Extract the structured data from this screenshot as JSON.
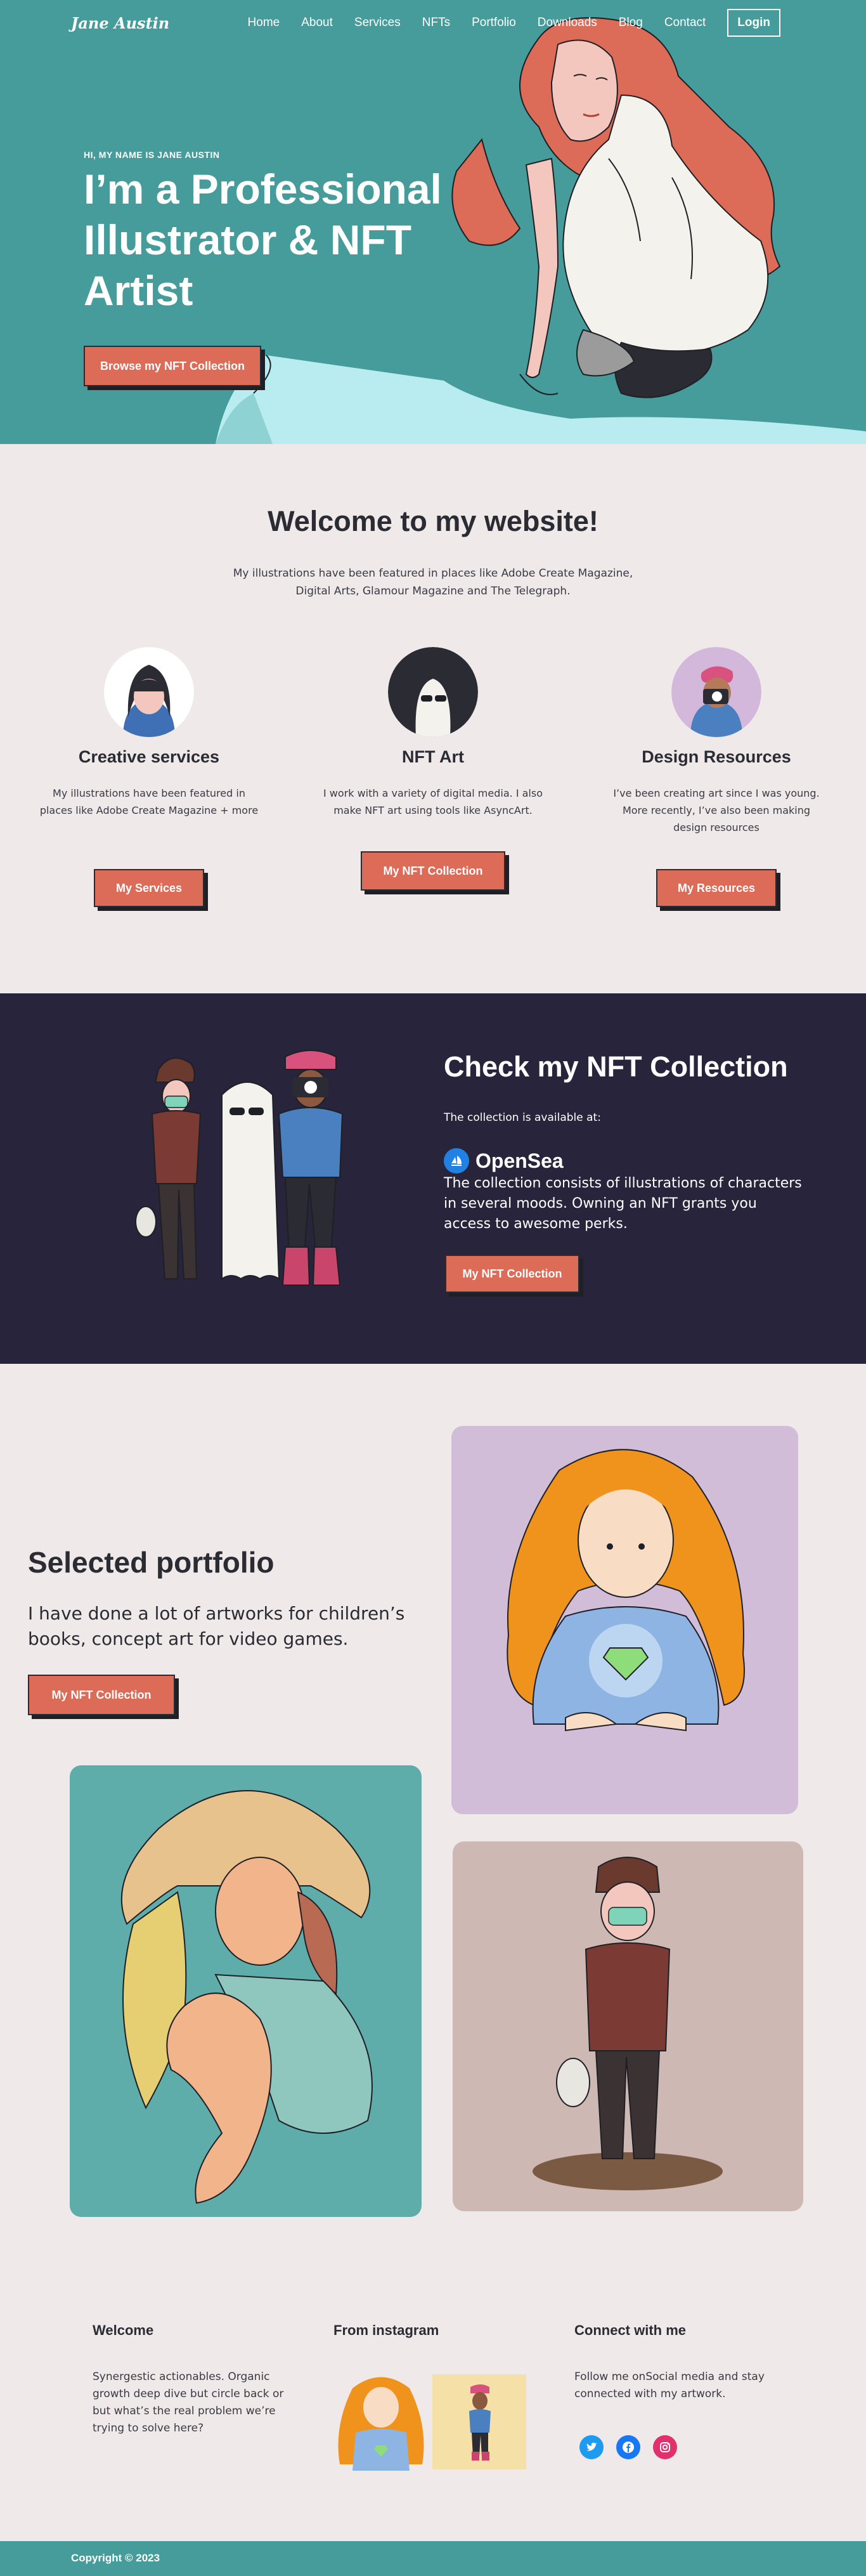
{
  "header": {
    "logo": "Jane Austin",
    "nav": [
      "Home",
      "About",
      "Services",
      "NFTs",
      "Portfolio",
      "Downloads",
      "Blog",
      "Contact"
    ],
    "login": "Login"
  },
  "hero": {
    "eyebrow": "HI, MY NAME IS JANE AUSTIN",
    "title": "I’m a Professional Illustrator & NFT Artist",
    "cta": "Browse my NFT Collection"
  },
  "welcome": {
    "title": "Welcome to my website!",
    "subtitle": "My illustrations have been featured in places like Adobe Create Magazine, Digital Arts, Glamour Magazine and The Telegraph.",
    "services": [
      {
        "title": "Creative services",
        "text": "My illustrations have been featured in places like Adobe Create Magazine + more",
        "button": "My Services"
      },
      {
        "title": "NFT Art",
        "text": "I work with a variety of digital media. I also make NFT art using tools like AsyncArt.",
        "button": "My NFT Collection"
      },
      {
        "title": "Design Resources",
        "text": "I’ve been creating art since I was young. More recently, I’ve also been making design resources",
        "button": "My Resources"
      }
    ]
  },
  "nft": {
    "title": "Check my NFT Collection",
    "available": "The collection is available at:",
    "marketplace": "OpenSea",
    "description": "The collection consists of illustrations of characters in several moods. Owning an NFT grants you access to awesome perks.",
    "button": "My NFT Collection"
  },
  "portfolio": {
    "title": "Selected portfolio",
    "description": "I have done a lot of artworks for children’s books, concept art for video games.",
    "button": "My NFT Collection"
  },
  "footer": {
    "welcome_title": "Welcome",
    "welcome_text": "Synergestic actionables. Organic growth deep dive but circle back or but what’s the real problem we’re trying to solve here?",
    "instagram_title": "From instagram",
    "connect_title": "Connect with me",
    "connect_text": "Follow me onSocial media and stay connected with my artwork.",
    "social": [
      "twitter-icon",
      "facebook-icon",
      "instagram-icon"
    ],
    "copyright": "Copyright © 2023"
  },
  "colors": {
    "teal": "#459c9a",
    "coral": "#dc6b58",
    "navy": "#27243b",
    "background": "#efe9e9"
  }
}
